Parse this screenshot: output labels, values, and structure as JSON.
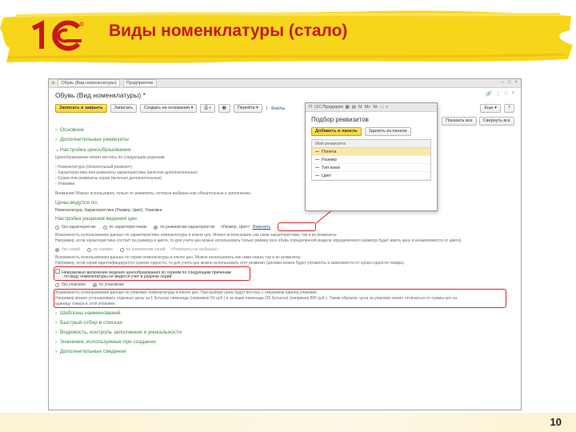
{
  "slide": {
    "title": "Виды номенклатуры (стало)",
    "page_number": "10",
    "colors": {
      "title": "#c8171e",
      "brush": "#f7d51a",
      "logo": "#c8171e"
    }
  },
  "window": {
    "tabs": [
      "Обувь (Вид номенклатуры)",
      "Предприятие"
    ],
    "form_title": "Обувь (Вид номенклатуры) *",
    "toolbar": {
      "save_close": "Записать и закрыть",
      "save": "Записать",
      "create_based": "Создать на основании",
      "goto": "Перейти",
      "files": "Файлы",
      "more": "Еще",
      "help": "?",
      "show_all": "Показать все",
      "collapse_all": "Свернуть все"
    },
    "sections": {
      "main": "Основное",
      "extra_props": "Дополнительные реквизиты",
      "pricing": "Настройка ценообразования",
      "templates": "Шаблоны наименований",
      "quick_select": "Быстрый отбор в списках",
      "visibility": "Видимость, контроль заполнения и уникальности",
      "defaults": "Значения, используемые при создании",
      "extra_info": "Дополнительные сведения"
    },
    "pricing": {
      "intro": "Ценообразование может вестись по следующим разрезам:",
      "list": [
        "- Номенклатура (обязательный реквизит)",
        "- Характеристики или реквизиты характеристики (включая дополнительные)",
        "- Серии или реквизиты серии (включая дополнительные)",
        "- Упаковки"
      ],
      "warning": "Внимание! Можно использовать только те реквизиты, которые выбраны как обязательные к заполнению.",
      "prices_by_label": "Цены ведутся по:",
      "prices_by_value": "Номенклатура, Характеристика (Размер, Цвет), Упаковка",
      "slices_title": "Настройка разрезов ведения цен",
      "char_options": [
        "без характеристик",
        "по характеристикам",
        "по реквизитам характеристик"
      ],
      "char_fields": "<Размер, Цвет>",
      "change_link": "Изменить",
      "char_note_1": "Возможность использования данных по характеристике номенклатуры в ключе цен. Можно использовать как сами характеристики, так и их реквизиты.",
      "char_note_2": "Например, если характеристика состоит из размера и цвета, то для учета цен можно использовать только размер (все обувь определенной модели определенного размера будет иметь цену в независимости от цвета).",
      "series_options": [
        "без серий",
        "по сериям",
        "по реквизитам серий"
      ],
      "series_fields": "<Реквизиты не выбраны>",
      "series_note_1": "Возможность использования данных по серии номенклатуры в ключе цен. Можно использовать как сами серии, так и их реквизиты.",
      "series_note_2": "Например, если серии идентифицируются сроком годности, то для учета цен можно использовать этот реквизит (ценами можно будет управлять в зависимости от срока годности товара).",
      "impossible_line_1": "Невозможно включение ведения ценообразования по сериям по следующим причинам:",
      "impossible_line_2": "- по виду номенклатуры не ведется учет в разрезе серий",
      "pack_options": [
        "без упаковок",
        "по упаковкам"
      ],
      "pack_note_1": "Возможность использования данных по упаковке номенклатуры в ключе цен. При выборе цены будут вестись с указанием единиц упаковки.",
      "pack_note_2": "Например можно устанавливать отдельно цены за 1 бутылку лимонада (например 50 руб.) и за ящик лимонада (20 бутылок) (например 800 руб.). Таким образом, цена за упаковку может отличаться от суммы цен за",
      "pack_note_3": "единицу товара в этой упаковке."
    }
  },
  "popup": {
    "bar": [
      "П",
      "(1С:Предприя",
      "М",
      "М+",
      "М-",
      "□",
      "×"
    ],
    "title": "Подбор реквизитов",
    "add_button": "Добавить в панель",
    "remove_button": "Удалить из панели",
    "column_header": "Имя реквизита",
    "rows": [
      "Понета",
      "Размер",
      "Тип кожи",
      "Цвет"
    ],
    "selected_index": 0
  }
}
